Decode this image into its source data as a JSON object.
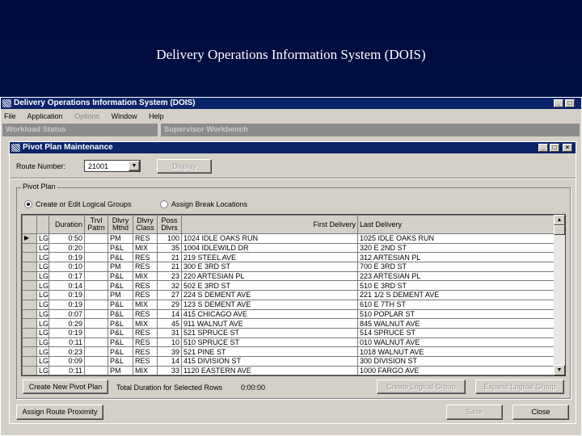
{
  "slide_title": "Delivery Operations Information System (DOIS)",
  "app": {
    "title": "Delivery Operations Information System (DOIS)",
    "menu": [
      "File",
      "Application",
      "Options",
      "Window",
      "Help"
    ],
    "panels": [
      "Workload Status",
      "Supervisor Workbench"
    ]
  },
  "dialog": {
    "title": "Pivot Plan Maintenance",
    "route_label": "Route Number:",
    "route_value": "21001",
    "display_button": "Display",
    "group_label": "Pivot Plan",
    "radio_create": "Create or Edit Logical Groups",
    "radio_assign": "Assign Break Locations",
    "columns": [
      "",
      "Duration",
      "Trvl Patrn",
      "Dlvry Mthd",
      "Dlvry Class",
      "Poss Dlvrs",
      "First Delivery",
      "Last Delivery"
    ],
    "rows": [
      [
        "LG",
        "0:50",
        "",
        "PM",
        "RES",
        "100",
        "1024 IDLE OAKS RUN",
        "1025 IDLE OAKS RUN"
      ],
      [
        "LG",
        "0:20",
        "",
        "P&L",
        "MIX",
        "35",
        "1004 IDLEWILD DR",
        "320 E 2ND ST"
      ],
      [
        "LG",
        "0:19",
        "",
        "P&L",
        "RES",
        "21",
        "219 STEEL AVE",
        "312 ARTESIAN PL"
      ],
      [
        "LG",
        "0:10",
        "",
        "PM",
        "RES",
        "21",
        "300 E 3RD ST",
        "700 E 3RD ST"
      ],
      [
        "LG",
        "0:17",
        "",
        "P&L",
        "MIX",
        "23",
        "220 ARTESIAN PL",
        "223 ARTESIAN PL"
      ],
      [
        "LG",
        "0:14",
        "",
        "P&L",
        "RES",
        "32",
        "502 E 3RD ST",
        "510 E 3RD ST"
      ],
      [
        "LG",
        "0:19",
        "",
        "PM",
        "RES",
        "27",
        "224 S DEMENT AVE",
        "221 1/2 S DEMENT AVE"
      ],
      [
        "LG",
        "0:19",
        "",
        "P&L",
        "MIX",
        "29",
        "123 S DEMENT AVE",
        "610 E 7TH ST"
      ],
      [
        "LG",
        "0:07",
        "",
        "P&L",
        "RES",
        "14",
        "415 CHICAGO AVE",
        "510 POPLAR ST"
      ],
      [
        "LG",
        "0:29",
        "",
        "P&L",
        "MIX",
        "45",
        "911 WALNUT AVE",
        "845 WALNUT AVE"
      ],
      [
        "LG",
        "0:19",
        "",
        "P&L",
        "RES",
        "31",
        "521 SPRUCE ST",
        "514 SPRUCE ST"
      ],
      [
        "LG",
        "0:11",
        "",
        "P&L",
        "RES",
        "10",
        "510 SPRUCE ST",
        "010 WALNUT AVE"
      ],
      [
        "LG",
        "0:23",
        "",
        "P&L",
        "RES",
        "39",
        "521 PINE ST",
        "1018 WALNUT AVE"
      ],
      [
        "LG",
        "0:09",
        "",
        "P&L",
        "RES",
        "14",
        "415 DIVISION ST",
        "300 DIVISION ST"
      ],
      [
        "LG",
        "0:11",
        "",
        "PM",
        "MIX",
        "33",
        "1120 EASTERN AVE",
        "1000 FARGO AVE"
      ]
    ],
    "create_pivot_button": "Create New Pivot Plan",
    "total_label": "Total Duration for Selected Rows",
    "total_value": "0:00:00",
    "create_group_button": "Create Logical Group",
    "expand_group_button": "Expand Logical Group",
    "assign_button": "Assign Route Proximity",
    "save_button": "Save",
    "close_button": "Close"
  }
}
